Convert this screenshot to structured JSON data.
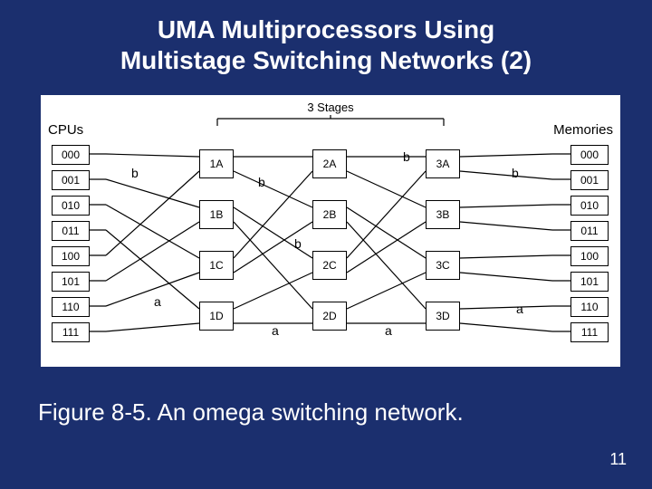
{
  "title_line1": "UMA Multiprocessors Using",
  "title_line2": "Multistage Switching Networks (2)",
  "caption": "Figure 8-5. An omega switching network.",
  "page_number": "11",
  "headers": {
    "cpus": "CPUs",
    "memories": "Memories",
    "stages": "3 Stages"
  },
  "cpu_labels": [
    "000",
    "001",
    "010",
    "011",
    "100",
    "101",
    "110",
    "111"
  ],
  "memory_labels": [
    "000",
    "001",
    "010",
    "011",
    "100",
    "101",
    "110",
    "111"
  ],
  "stage1": [
    "1A",
    "1B",
    "1C",
    "1D"
  ],
  "stage2": [
    "2A",
    "2B",
    "2C",
    "2D"
  ],
  "stage3": [
    "3A",
    "3B",
    "3C",
    "3D"
  ],
  "wire_labels": {
    "a": "a",
    "b": "b"
  }
}
